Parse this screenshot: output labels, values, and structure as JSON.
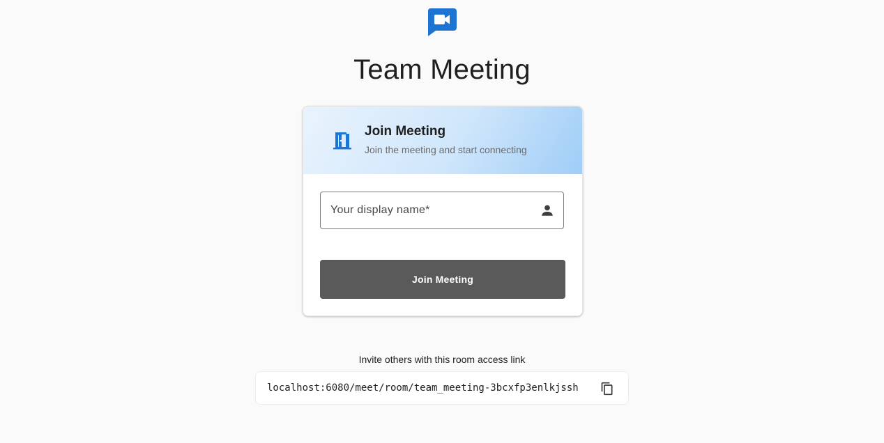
{
  "page": {
    "title": "Team Meeting"
  },
  "card": {
    "header_title": "Join Meeting",
    "header_subtitle": "Join the meeting and start connecting",
    "name_placeholder": "Your display name*",
    "name_value": "",
    "join_button_label": "Join Meeting"
  },
  "invite": {
    "text": "Invite others with this room access link",
    "link": "localhost:6080/meet/room/team_meeting-3bcxfp3enlkjssh"
  },
  "icons": {
    "logo": "video-chat-icon",
    "header": "door-open-icon",
    "field": "person-icon",
    "copy": "copy-icon"
  },
  "colors": {
    "brand_blue": "#1e74d2",
    "button_bg": "#5a5a5a",
    "page_bg": "#fafafa"
  }
}
